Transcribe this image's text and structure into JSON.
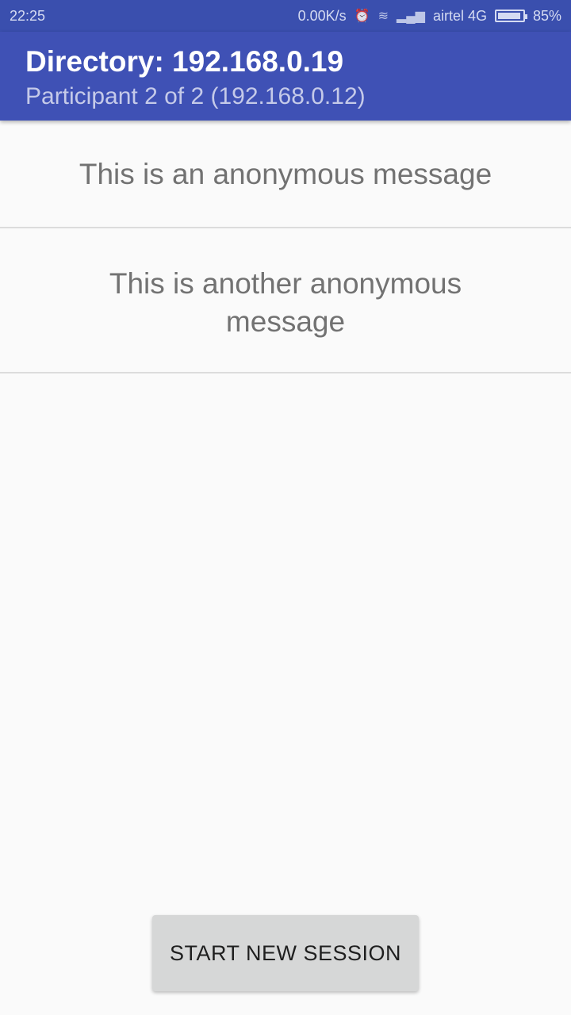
{
  "status_bar": {
    "time": "22:25",
    "network_speed": "0.00K/s",
    "carrier": "airtel 4G",
    "battery": "85%",
    "icons": [
      "alarm-icon",
      "wifi-icon",
      "signal-icon",
      "battery-icon"
    ]
  },
  "app_bar": {
    "title": "Directory: 192.168.0.19",
    "subtitle": "Participant 2 of 2 (192.168.0.12)",
    "color": "#3f51b5"
  },
  "messages": [
    {
      "text": "This is an anonymous message"
    },
    {
      "text": "This is another anonymous message"
    }
  ],
  "actions": {
    "start_new_session": "START NEW SESSION"
  }
}
